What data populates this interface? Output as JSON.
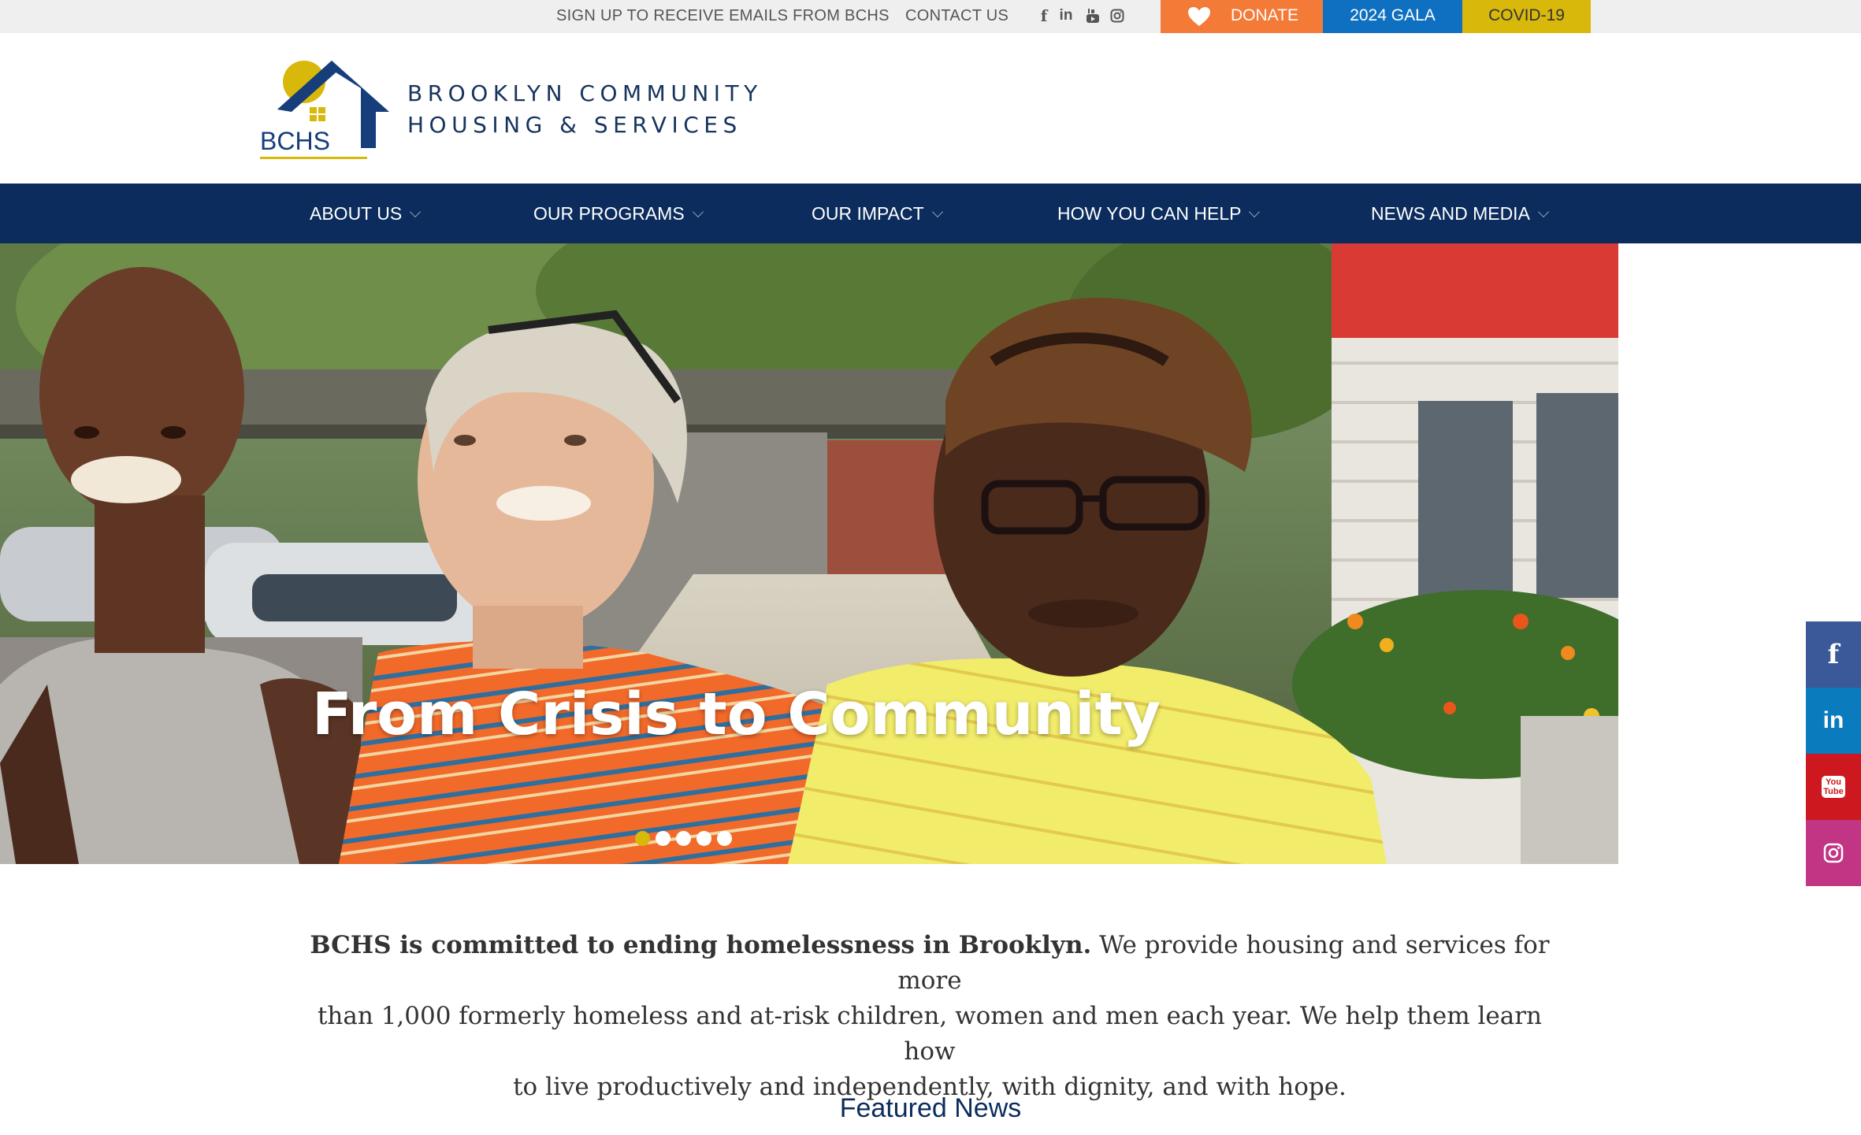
{
  "topbar": {
    "signup_label": "SIGN UP TO RECEIVE EMAILS FROM BCHS",
    "contact_label": "CONTACT US",
    "social_icons": [
      "facebook-icon",
      "linkedin-icon",
      "youtube-icon",
      "instagram-icon"
    ],
    "donate_label": "DONATE",
    "gala_label": "2024 GALA",
    "covid_label": "COVID-19"
  },
  "header": {
    "logo_text": "BCHS",
    "org_name_line1": "BROOKLYN COMMUNITY",
    "org_name_line2": "HOUSING & SERVICES"
  },
  "nav": {
    "items": [
      {
        "label": "ABOUT US"
      },
      {
        "label": "OUR PROGRAMS"
      },
      {
        "label": "OUR IMPACT"
      },
      {
        "label": "HOW YOU CAN HELP"
      },
      {
        "label": "NEWS AND MEDIA"
      }
    ]
  },
  "hero": {
    "caption": "From Crisis to Community",
    "slide_count": 5,
    "active_slide": 1
  },
  "side_social": {
    "facebook": "f",
    "linkedin": "in",
    "youtube": "You Tube"
  },
  "mission": {
    "bold_text": "BCHS is committed to ending homelessness in Brooklyn.",
    "line1_rest": " We provide housing and services for more",
    "line2": "than 1,000 formerly homeless and at-risk children, women and men each year. We help them learn how",
    "line3": "to live productively and independently, with dignity, and with hope."
  },
  "featured": {
    "title": "Featured News"
  },
  "colors": {
    "navy": "#0b2c5c",
    "donate": "#f47a38",
    "gala": "#0f6fc0",
    "covid": "#d9b80c"
  }
}
